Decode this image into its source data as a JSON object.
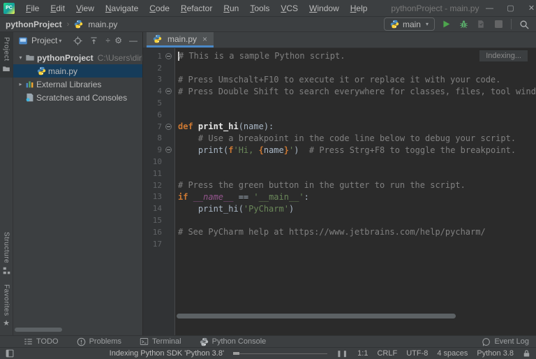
{
  "window": {
    "title": "pythonProject - main.py",
    "logo_text": "PC",
    "controls": {
      "minimize": "—",
      "maximize": "▢",
      "close": "✕"
    }
  },
  "menu": {
    "items": [
      "File",
      "Edit",
      "View",
      "Navigate",
      "Code",
      "Refactor",
      "Run",
      "Tools",
      "VCS",
      "Window",
      "Help"
    ]
  },
  "glyphs": {
    "chevron_down": "▾",
    "chevron_right": "▸",
    "divide": "÷",
    "gear": "⚙",
    "minus": "—",
    "star": "★",
    "pause": "❚❚",
    "crumb_sep": "›"
  },
  "navbar": {
    "breadcrumbs": [
      {
        "label": "pythonProject"
      },
      {
        "label": "main.py",
        "icon": "python"
      }
    ],
    "run_config": {
      "icon": "python",
      "label": "main"
    },
    "action_icons": [
      "run",
      "debug",
      "coverage",
      "stop",
      "search"
    ]
  },
  "stripe": {
    "top": [
      {
        "label": "Project",
        "icon": "folder-tab",
        "active": true
      }
    ],
    "bottom": [
      {
        "label": "Structure",
        "icon": "structure"
      },
      {
        "label": "Favorites",
        "icon": "star"
      }
    ]
  },
  "project_panel": {
    "header": {
      "label": "Project",
      "icons": [
        "project-view",
        "locate",
        "collapse-all",
        "expand-collapse",
        "settings",
        "hide"
      ]
    },
    "tree": [
      {
        "name": "pythonProject",
        "path": "C:\\Users\\dirkk\\Pyc",
        "icon": "folder",
        "chevron": "down",
        "bold": true,
        "indent": 0
      },
      {
        "name": "main.py",
        "icon": "python",
        "selected": true,
        "indent": 1
      },
      {
        "name": "External Libraries",
        "icon": "libraries",
        "chevron": "right",
        "indent": 0
      },
      {
        "name": "Scratches and Consoles",
        "icon": "scratches",
        "indent": 0
      }
    ]
  },
  "editor": {
    "tab": {
      "label": "main.py",
      "icon": "python",
      "close": "×"
    },
    "indexing_label": "Indexing...",
    "folds": [
      1,
      4,
      7,
      9
    ],
    "caret": {
      "line": 1,
      "column": 1
    },
    "lines": [
      {
        "n": 1,
        "seg": [
          [
            "comment",
            "# This is a sample Python script."
          ]
        ]
      },
      {
        "n": 2,
        "seg": []
      },
      {
        "n": 3,
        "seg": [
          [
            "comment",
            "# Press Umschalt+F10 to execute it or replace it with your code."
          ]
        ]
      },
      {
        "n": 4,
        "seg": [
          [
            "comment",
            "# Press Double Shift to search everywhere for classes, files, tool windows, acti"
          ]
        ]
      },
      {
        "n": 5,
        "seg": []
      },
      {
        "n": 6,
        "seg": []
      },
      {
        "n": 7,
        "seg": [
          [
            "kw",
            "def "
          ],
          [
            "func",
            "print_hi"
          ],
          [
            "text",
            "(name):"
          ]
        ]
      },
      {
        "n": 8,
        "seg": [
          [
            "comment",
            "    # Use a breakpoint in the code line below to debug your script."
          ]
        ]
      },
      {
        "n": 9,
        "seg": [
          [
            "text",
            "    print("
          ],
          [
            "kw",
            "f"
          ],
          [
            "str",
            "'Hi, "
          ],
          [
            "brace",
            "{"
          ],
          [
            "text",
            "name"
          ],
          [
            "brace",
            "}"
          ],
          [
            "str",
            "'"
          ],
          [
            "text",
            ")"
          ],
          [
            "comment",
            "  # Press Strg+F8 to toggle the breakpoint."
          ]
        ]
      },
      {
        "n": 10,
        "seg": []
      },
      {
        "n": 11,
        "seg": []
      },
      {
        "n": 12,
        "seg": [
          [
            "comment",
            "# Press the green button in the gutter to run the script."
          ]
        ]
      },
      {
        "n": 13,
        "seg": [
          [
            "kw",
            "if "
          ],
          [
            "dunder",
            "__name__"
          ],
          [
            "text",
            " == "
          ],
          [
            "str",
            "'__main__'"
          ],
          [
            "text",
            ":"
          ]
        ]
      },
      {
        "n": 14,
        "seg": [
          [
            "text",
            "    print_hi("
          ],
          [
            "str",
            "'PyCharm'"
          ],
          [
            "text",
            ")"
          ]
        ]
      },
      {
        "n": 15,
        "seg": []
      },
      {
        "n": 16,
        "seg": [
          [
            "comment",
            "# See PyCharm help at https://www.jetbrains.com/help/pycharm/"
          ]
        ]
      },
      {
        "n": 17,
        "seg": []
      }
    ]
  },
  "bottom_bar": {
    "buttons": [
      {
        "label": "TODO",
        "icon": "todo"
      },
      {
        "label": "Problems",
        "icon": "problems"
      },
      {
        "label": "Terminal",
        "icon": "terminal"
      },
      {
        "label": "Python Console",
        "icon": "python-gray"
      }
    ],
    "event_log": {
      "label": "Event Log",
      "icon": "bubble"
    }
  },
  "status_bar": {
    "message": "Indexing Python SDK 'Python 3.8'",
    "position": "1:1",
    "line_ending": "CRLF",
    "encoding": "UTF-8",
    "indent": "4 spaces",
    "interpreter": "Python 3.8"
  },
  "colors": {
    "panel_bg": "#3c3f41",
    "editor_bg": "#2b2b2b",
    "gutter_bg": "#313335",
    "accent_blue": "#4a88c7",
    "selection_blue": "#163c5a",
    "keyword": "#cc7832",
    "string": "#6a8759",
    "comment": "#808080",
    "default_text": "#a9b7c6",
    "dunder": "#94558d",
    "run_green": "#4da54d"
  }
}
